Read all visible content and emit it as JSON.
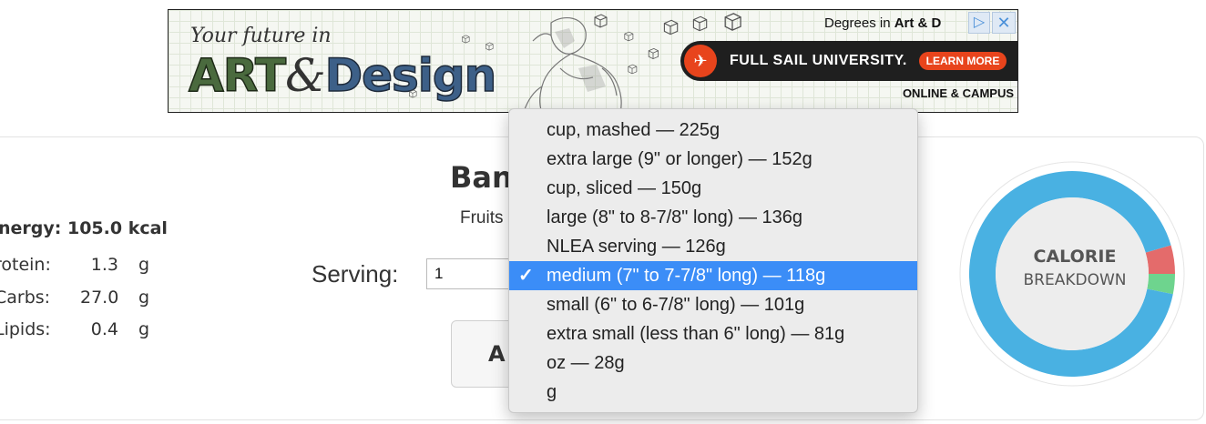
{
  "ad": {
    "tagline": "Your future in",
    "headline_part1": "ART",
    "headline_amp": "&",
    "headline_part2": "Design",
    "degrees_prefix": "Degrees in ",
    "degrees_emph": "Art & D",
    "school": "FULL SAIL UNIVERSITY.",
    "cta": "LEARN MORE",
    "delivery": "ONLINE & CAMPUS",
    "adchoices_icon": "adchoices-icon",
    "close_icon": "close-icon",
    "plane_icon": "plane-icon",
    "plane_glyph": "✈",
    "adchoices_glyph": "▷",
    "close_glyph": "✕",
    "colors": {
      "brand": "#e8441c",
      "dark": "#1f1f1f"
    }
  },
  "food": {
    "title": "Ban",
    "category": "Fruits"
  },
  "nutrition": {
    "energy": "nergy: 105.0 kcal",
    "rows": [
      {
        "label": "rotein:",
        "value": "1.3",
        "unit": "g"
      },
      {
        "label": "Carbs:",
        "value": "27.0",
        "unit": "g"
      },
      {
        "label": "Lipids:",
        "value": "0.4",
        "unit": "g"
      }
    ]
  },
  "serving": {
    "label": "Serving:",
    "value": "1"
  },
  "add_button": {
    "label": "A"
  },
  "dropdown": {
    "check_glyph": "✓",
    "options": [
      "cup, mashed — 225g",
      "extra large (9\" or longer) — 152g",
      "cup, sliced — 150g",
      "large (8\" to 8-7/8\" long) — 136g",
      "NLEA serving — 126g",
      "medium (7\" to 7-7/8\" long) — 118g",
      "small (6\" to 6-7/8\" long) — 101g",
      "extra small (less than 6\" long) — 81g",
      "oz — 28g",
      "g"
    ],
    "selected_index": 5,
    "colors": {
      "selected_bg": "#3b8df7"
    }
  },
  "calorie_chart": {
    "label_line1": "CALORIE",
    "label_line2": "BREAKDOWN",
    "carbs_percent": 90.5,
    "protein_percent": 4.4,
    "lipids_percent": 3.1,
    "colors": {
      "carbs": "#49b1e2",
      "protein": "#e46b6b",
      "lipids": "#6ed48e"
    }
  }
}
